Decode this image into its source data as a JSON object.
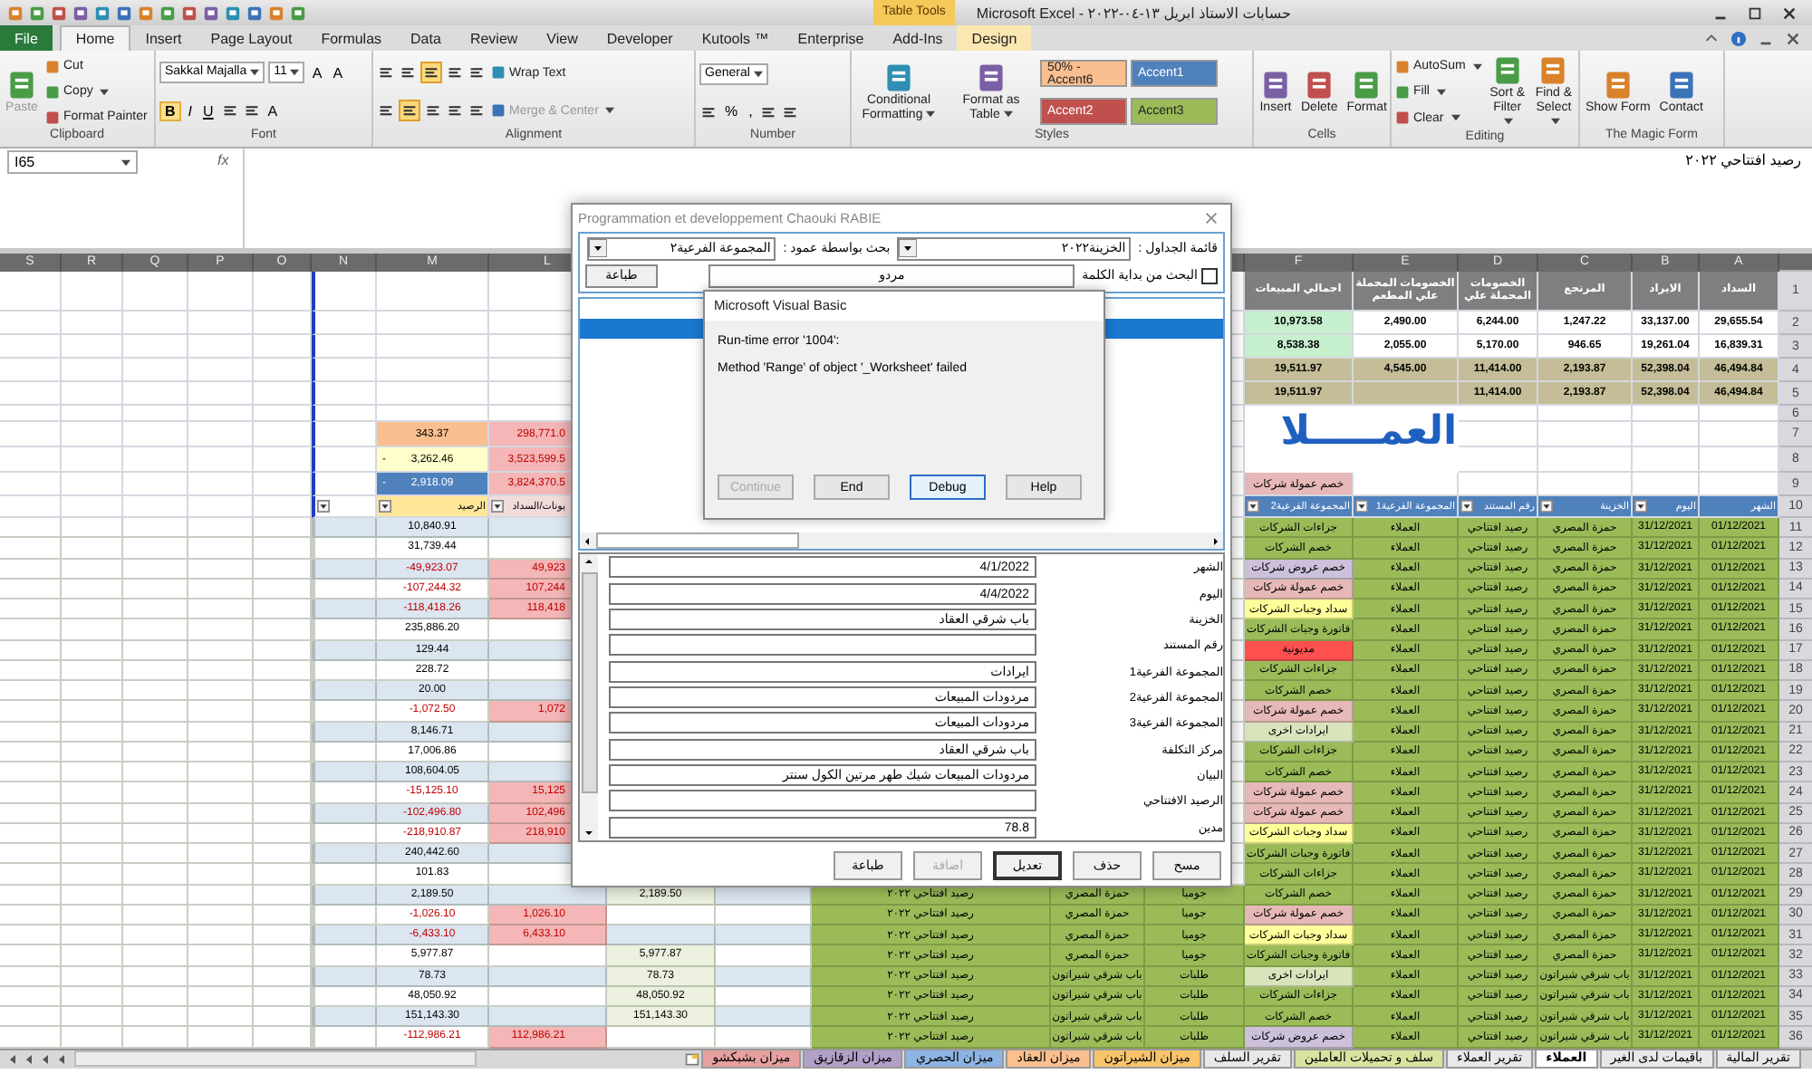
{
  "window": {
    "title": "حسابات الاستاذ ابريل ١٣-٠٤-٢٠٢٢ - Microsoft Excel",
    "contextual_tab": "Table Tools"
  },
  "ribbon": {
    "tabs": [
      {
        "label": "Design",
        "kind": "contextual",
        "selected": false
      },
      {
        "label": "Add-Ins",
        "kind": "normal",
        "selected": false
      },
      {
        "label": "Enterprise",
        "kind": "normal",
        "selected": false
      },
      {
        "label": "Kutools ™",
        "kind": "normal",
        "selected": false
      },
      {
        "label": "Developer",
        "kind": "normal",
        "selected": false
      },
      {
        "label": "View",
        "kind": "normal",
        "selected": false
      },
      {
        "label": "Review",
        "kind": "normal",
        "selected": false
      },
      {
        "label": "Data",
        "kind": "normal",
        "selected": false
      },
      {
        "label": "Formulas",
        "kind": "normal",
        "selected": false
      },
      {
        "label": "Page Layout",
        "kind": "normal",
        "selected": false
      },
      {
        "label": "Insert",
        "kind": "normal",
        "selected": false
      },
      {
        "label": "Home",
        "kind": "normal",
        "selected": true
      },
      {
        "label": "File",
        "kind": "file",
        "selected": false
      }
    ],
    "groups": [
      {
        "label": "The Magic Form",
        "columns": [
          [
            [
              {
                "kind": "large",
                "label": "Contact"
              }
            ]
          ],
          [
            [
              {
                "kind": "large",
                "label": "Show Form"
              }
            ]
          ]
        ]
      },
      {
        "label": "Editing",
        "columns": [
          [
            [
              {
                "kind": "large",
                "label": "Find & Select",
                "dropdown": true
              }
            ]
          ],
          [
            [
              {
                "kind": "large",
                "label": "Sort & Filter",
                "dropdown": true
              }
            ]
          ],
          [
            [
              {
                "kind": "small",
                "label": "AutoSum",
                "dropdown": true
              }
            ],
            [
              {
                "kind": "small",
                "label": "Fill",
                "dropdown": true
              }
            ],
            [
              {
                "kind": "small",
                "label": "Clear",
                "dropdown": true
              }
            ]
          ]
        ]
      },
      {
        "label": "Cells",
        "columns": [
          [
            [
              {
                "kind": "large",
                "label": "Format"
              }
            ]
          ],
          [
            [
              {
                "kind": "large",
                "label": "Delete"
              }
            ]
          ],
          [
            [
              {
                "kind": "large",
                "label": "Insert"
              }
            ]
          ]
        ]
      },
      {
        "label": "Styles",
        "columns": [
          [
            [
              {
                "kind": "swatch",
                "label": "Accent1",
                "color": "#4f81bd"
              },
              {
                "kind": "swatch",
                "label": "50% - Accent6",
                "color": "#fabf8f"
              }
            ],
            [
              {
                "kind": "swatch",
                "label": "Accent3",
                "color": "#9bbb59"
              },
              {
                "kind": "swatch",
                "label": "Accent2",
                "color": "#c0504d"
              }
            ]
          ],
          [
            [
              {
                "kind": "large",
                "label": "Format as Table",
                "dropdown": true
              }
            ]
          ],
          [
            [
              {
                "kind": "large",
                "label": "Conditional Formatting",
                "dropdown": true
              }
            ]
          ]
        ]
      },
      {
        "label": "Number",
        "columns": [
          [
            [
              {
                "kind": "field",
                "label": "General"
              }
            ],
            [
              {
                "kind": "icon",
                "selected": false
              },
              {
                "kind": "icon",
                "selected": false
              },
              {
                "kind": "glyph",
                "label": ","
              },
              {
                "kind": "glyph",
                "label": "%"
              },
              {
                "kind": "icon",
                "selected": false
              }
            ]
          ]
        ]
      },
      {
        "label": "Alignment",
        "columns": [
          [
            [
              {
                "kind": "small",
                "label": "Wrap Text"
              }
            ],
            [
              {
                "kind": "small",
                "label": "Merge & Center",
                "dropdown": true,
                "disabled": true
              }
            ]
          ],
          [
            [
              {
                "kind": "icon",
                "selected": false
              },
              {
                "kind": "icon",
                "selected": false
              },
              {
                "kind": "icon",
                "selected": true
              },
              {
                "kind": "icon",
                "selected": false
              },
              {
                "kind": "icon",
                "selected": false
              }
            ],
            [
              {
                "kind": "icon",
                "selected": false
              },
              {
                "kind": "icon",
                "selected": false
              },
              {
                "kind": "icon",
                "selected": false
              },
              {
                "kind": "icon",
                "selected": true
              },
              {
                "kind": "icon",
                "selected": false
              }
            ]
          ]
        ]
      },
      {
        "label": "Font",
        "columns": [
          [
            [
              {
                "kind": "glyph",
                "label": "A"
              },
              {
                "kind": "glyph",
                "label": "A"
              },
              {
                "kind": "field",
                "label": "11"
              },
              {
                "kind": "field",
                "label": "Sakkal Majalla"
              }
            ],
            [
              {
                "kind": "glyph",
                "label": "A"
              },
              {
                "kind": "icon",
                "selected": false
              },
              {
                "kind": "icon",
                "selected": false
              },
              {
                "kind": "underline",
                "label": "U"
              },
              {
                "kind": "italic",
                "label": "I"
              },
              {
                "kind": "bold",
                "label": "B"
              }
            ]
          ]
        ]
      },
      {
        "label": "Clipboard",
        "columns": [
          [
            [
              {
                "kind": "small",
                "label": "Cut"
              }
            ],
            [
              {
                "kind": "small",
                "label": "Copy",
                "dropdown": true
              }
            ],
            [
              {
                "kind": "small",
                "label": "Format Painter"
              }
            ]
          ],
          [
            [
              {
                "kind": "large",
                "label": "Paste",
                "disabled": true
              }
            ]
          ]
        ]
      }
    ]
  },
  "formula_bar": {
    "name_box": "I65",
    "fx": "fx",
    "content": "رصيد افتتاحي ٢٠٢٢"
  },
  "sheet": {
    "columns": [
      "A",
      "B",
      "C",
      "D",
      "E",
      "F",
      "L",
      "M",
      "N",
      "O",
      "P",
      "Q",
      "R",
      "S"
    ],
    "title": "العمـــــلا",
    "rows": [
      {
        "row": "1",
        "kind": "head",
        "cells": {
          "F": {
            "text": "اجمالي المبيعات",
            "color": "#7f7f7f"
          },
          "E": {
            "text": "الخصومات المحملة علي المطعم",
            "color": "#7f7f7f"
          },
          "D": {
            "text": "الخصومات المحملة علي",
            "color": "#7f7f7f"
          },
          "C": {
            "text": "المرتجع",
            "color": "#7f7f7f"
          },
          "B": {
            "text": "الايراد",
            "color": "#7f7f7f"
          },
          "A": {
            "text": "السداد",
            "color": "#7f7f7f"
          }
        }
      },
      {
        "row": "2",
        "kind": "summary",
        "cells": {
          "F": {
            "text": "10,973.58",
            "color": "#c6efce"
          },
          "E": {
            "text": "2,490.00"
          },
          "D": {
            "text": "6,244.00"
          },
          "C": {
            "text": "1,247.22"
          },
          "B": {
            "text": "33,137.00"
          },
          "A": {
            "text": "29,655.54"
          }
        }
      },
      {
        "row": "3",
        "kind": "summary",
        "cells": {
          "F": {
            "text": "8,538.38",
            "color": "#c6efce"
          },
          "E": {
            "text": "2,055.00"
          },
          "D": {
            "text": "5,170.00"
          },
          "C": {
            "text": "946.65"
          },
          "B": {
            "text": "19,261.04"
          },
          "A": {
            "text": "16,839.31"
          }
        }
      },
      {
        "row": "4",
        "kind": "summary",
        "cells": {
          "F": {
            "text": "19,511.97",
            "color": "#c4bd97"
          },
          "E": {
            "text": "4,545.00",
            "color": "#c4bd97"
          },
          "D": {
            "text": "11,414.00",
            "color": "#c4bd97"
          },
          "C": {
            "text": "2,193.87",
            "color": "#c4bd97"
          },
          "B": {
            "text": "52,398.04",
            "color": "#c4bd97"
          },
          "A": {
            "text": "46,494.84",
            "color": "#c4bd97"
          }
        }
      },
      {
        "row": "5",
        "kind": "summary",
        "cells": {
          "F": {
            "text": "19,511.97",
            "color": "#c4bd97"
          },
          "E": {
            "color": "#c4bd97"
          },
          "D": {
            "text": "11,414.00",
            "color": "#c4bd97"
          },
          "C": {
            "text": "2,193.87",
            "color": "#c4bd97"
          },
          "B": {
            "text": "52,398.04",
            "color": "#c4bd97"
          },
          "A": {
            "text": "46,494.84",
            "color": "#c4bd97"
          }
        }
      },
      {
        "row": "6"
      },
      {
        "row": "7",
        "cells": {
          "M": {
            "text": "343.37",
            "color": "#fabf8f"
          },
          "L": {
            "text": "298,771.0",
            "color": "#f4b6b6",
            "negative": true
          }
        }
      },
      {
        "row": "8",
        "cells": {
          "M": {
            "text": "3,262.46",
            "prefix": "-",
            "color": "#ffffcc"
          },
          "L": {
            "text": "3,523,599.5",
            "color": "#f4b6b6",
            "negative": true
          }
        }
      },
      {
        "row": "9",
        "cells": {
          "M": {
            "text": "2,918.09",
            "prefix": "-",
            "color": "#4f81bd"
          },
          "L": {
            "text": "3,824,370.5",
            "color": "#f4b6b6",
            "negative": true
          },
          "F": {
            "text": "خصم عمولة شركات",
            "color": "#e6b8b7"
          }
        }
      },
      {
        "row": "10",
        "kind": "table_head",
        "cells": {
          "N": {
            "filter": true
          },
          "M": {
            "text": "الرصيد",
            "color": "#ffe699",
            "filter": true
          },
          "L": {
            "text": "يونات/السداد",
            "color": "#f2dcdb",
            "filter": true
          },
          "F": {
            "text": "المجموعة الفرعية2",
            "color": "#4f81bd",
            "filter": true
          },
          "E": {
            "text": "المجموعة الفرعية1",
            "color": "#4f81bd",
            "filter": true
          },
          "D": {
            "text": "رقم المستند",
            "color": "#4f81bd",
            "filter": true
          },
          "C": {
            "text": "الخزينة",
            "color": "#4f81bd",
            "filter": true
          },
          "B": {
            "text": "اليوم",
            "color": "#4f81bd",
            "filter": true
          },
          "A": {
            "text": "الشهر",
            "color": "#4f81bd"
          }
        }
      },
      {
        "row": "11",
        "kind": "data",
        "cells": {
          "M": {
            "text": "10,840.91"
          },
          "F": {
            "text": "جزاءات الشركات"
          },
          "E": {
            "text": "العملاء"
          },
          "D": {
            "text": "رصيد افتتاحي"
          },
          "C": {
            "text": "حمزة المصري"
          },
          "B": {
            "text": "31/12/2021"
          },
          "A": {
            "text": "01/12/2021"
          }
        }
      },
      {
        "row": "12",
        "kind": "data",
        "cells": {
          "M": {
            "text": "31,739.44"
          },
          "F": {
            "text": "خصم الشركات"
          },
          "E": {
            "text": "العملاء"
          },
          "D": {
            "text": "رصيد افتتاحي"
          },
          "C": {
            "text": "حمزة المصري"
          },
          "B": {
            "text": "31/12/2021"
          },
          "A": {
            "text": "01/12/2021"
          }
        }
      },
      {
        "row": "13",
        "kind": "data",
        "cells": {
          "M": {
            "text": "-49,923.07",
            "negative": true
          },
          "L": {
            "text": "49,923",
            "color": "#f4b6b6",
            "negative": true
          },
          "F": {
            "text": "خصم عروض شركات",
            "color": "#ccc0da"
          },
          "E": {
            "text": "العملاء"
          },
          "D": {
            "text": "رصيد افتتاحي"
          },
          "C": {
            "text": "حمزة المصري"
          },
          "B": {
            "text": "31/12/2021"
          },
          "A": {
            "text": "01/12/2021"
          }
        }
      },
      {
        "row": "14",
        "kind": "data",
        "cells": {
          "M": {
            "text": "-107,244.32",
            "negative": true
          },
          "L": {
            "text": "107,244",
            "color": "#f4b6b6",
            "negative": true
          },
          "F": {
            "text": "خصم عمولة شركات",
            "color": "#e6b8b7"
          },
          "E": {
            "text": "العملاء"
          },
          "D": {
            "text": "رصيد افتتاحي"
          },
          "C": {
            "text": "حمزة المصري"
          },
          "B": {
            "text": "31/12/2021"
          },
          "A": {
            "text": "01/12/2021"
          }
        }
      },
      {
        "row": "15",
        "kind": "data",
        "cells": {
          "M": {
            "text": "-118,418.26",
            "negative": true
          },
          "L": {
            "text": "118,418",
            "color": "#f4b6b6",
            "negative": true
          },
          "F": {
            "text": "سداد وجبات الشركات",
            "color": "#ffff99"
          },
          "E": {
            "text": "العملاء"
          },
          "D": {
            "text": "رصيد افتتاحي"
          },
          "C": {
            "text": "حمزة المصري"
          },
          "B": {
            "text": "31/12/2021"
          },
          "A": {
            "text": "01/12/2021"
          }
        }
      },
      {
        "row": "16",
        "kind": "data",
        "cells": {
          "M": {
            "text": "235,886.20"
          },
          "F": {
            "text": "فاتورة وجبات الشركات"
          },
          "E": {
            "text": "العملاء"
          },
          "D": {
            "text": "رصيد افتتاحي"
          },
          "C": {
            "text": "حمزة المصري"
          },
          "B": {
            "text": "31/12/2021"
          },
          "A": {
            "text": "01/12/2021"
          }
        }
      },
      {
        "row": "17",
        "kind": "data",
        "cells": {
          "M": {
            "text": "129.44"
          },
          "F": {
            "text": "مديونية",
            "color": "#ff5050"
          },
          "E": {
            "text": "العملاء"
          },
          "D": {
            "text": "رصيد افتتاحي"
          },
          "C": {
            "text": "حمزة المصري"
          },
          "B": {
            "text": "31/12/2021"
          },
          "A": {
            "text": "01/12/2021"
          }
        }
      },
      {
        "row": "18",
        "kind": "data",
        "cells": {
          "M": {
            "text": "228.72"
          },
          "F": {
            "text": "جزاءات الشركات"
          },
          "E": {
            "text": "العملاء"
          },
          "D": {
            "text": "رصيد افتتاحي"
          },
          "C": {
            "text": "حمزة المصري"
          },
          "B": {
            "text": "31/12/2021"
          },
          "A": {
            "text": "01/12/2021"
          }
        }
      },
      {
        "row": "19",
        "kind": "data",
        "cells": {
          "M": {
            "text": "20.00"
          },
          "F": {
            "text": "خصم الشركات"
          },
          "E": {
            "text": "العملاء"
          },
          "D": {
            "text": "رصيد افتتاحي"
          },
          "C": {
            "text": "حمزة المصري"
          },
          "B": {
            "text": "31/12/2021"
          },
          "A": {
            "text": "01/12/2021"
          }
        }
      },
      {
        "row": "20",
        "kind": "data",
        "cells": {
          "M": {
            "text": "-1,072.50",
            "negative": true
          },
          "L": {
            "text": "1,072",
            "color": "#f4b6b6",
            "negative": true
          },
          "F": {
            "text": "خصم عمولة شركات",
            "color": "#e6b8b7"
          },
          "E": {
            "text": "العملاء"
          },
          "D": {
            "text": "رصيد افتتاحي"
          },
          "C": {
            "text": "حمزة المصري"
          },
          "B": {
            "text": "31/12/2021"
          },
          "A": {
            "text": "01/12/2021"
          }
        }
      },
      {
        "row": "21",
        "kind": "data",
        "cells": {
          "M": {
            "text": "8,146.71"
          },
          "F": {
            "text": "ايرادات اخرى",
            "color": "#d8e4bc"
          },
          "E": {
            "text": "العملاء"
          },
          "D": {
            "text": "رصيد افتتاحي"
          },
          "C": {
            "text": "حمزة المصري"
          },
          "B": {
            "text": "31/12/2021"
          },
          "A": {
            "text": "01/12/2021"
          }
        }
      },
      {
        "row": "22",
        "kind": "data",
        "cells": {
          "M": {
            "text": "17,006.86"
          },
          "F": {
            "text": "جزاءات الشركات"
          },
          "E": {
            "text": "العملاء"
          },
          "D": {
            "text": "رصيد افتتاحي"
          },
          "C": {
            "text": "حمزة المصري"
          },
          "B": {
            "text": "31/12/2021"
          },
          "A": {
            "text": "01/12/2021"
          }
        }
      },
      {
        "row": "23",
        "kind": "data",
        "cells": {
          "M": {
            "text": "108,604.05"
          },
          "F": {
            "text": "خصم الشركات"
          },
          "E": {
            "text": "العملاء"
          },
          "D": {
            "text": "رصيد افتتاحي"
          },
          "C": {
            "text": "حمزة المصري"
          },
          "B": {
            "text": "31/12/2021"
          },
          "A": {
            "text": "01/12/2021"
          }
        }
      },
      {
        "row": "24",
        "kind": "data",
        "cells": {
          "M": {
            "text": "-15,125.10",
            "negative": true
          },
          "L": {
            "text": "15,125",
            "color": "#f4b6b6",
            "negative": true
          },
          "F": {
            "text": "خصم عمولة شركات",
            "color": "#e6b8b7"
          },
          "E": {
            "text": "العملاء"
          },
          "D": {
            "text": "رصيد افتتاحي"
          },
          "C": {
            "text": "حمزة المصري"
          },
          "B": {
            "text": "31/12/2021"
          },
          "A": {
            "text": "01/12/2021"
          }
        }
      },
      {
        "row": "25",
        "kind": "data",
        "cells": {
          "M": {
            "text": "-102,496.80",
            "negative": true
          },
          "L": {
            "text": "102,496",
            "color": "#f4b6b6",
            "negative": true
          },
          "F": {
            "text": "خصم عمولة شركات",
            "color": "#e6b8b7"
          },
          "E": {
            "text": "العملاء"
          },
          "D": {
            "text": "رصيد افتتاحي"
          },
          "C": {
            "text": "حمزة المصري"
          },
          "B": {
            "text": "31/12/2021"
          },
          "A": {
            "text": "01/12/2021"
          }
        }
      },
      {
        "row": "26",
        "kind": "data",
        "cells": {
          "M": {
            "text": "-218,910.87",
            "negative": true
          },
          "L": {
            "text": "218,910",
            "color": "#f4b6b6",
            "negative": true
          },
          "F": {
            "text": "سداد وجبات الشركات",
            "color": "#ffff99"
          },
          "E": {
            "text": "العملاء"
          },
          "D": {
            "text": "رصيد افتتاحي"
          },
          "C": {
            "text": "حمزة المصري"
          },
          "B": {
            "text": "31/12/2021"
          },
          "A": {
            "text": "01/12/2021"
          }
        }
      },
      {
        "row": "27",
        "kind": "data",
        "cells": {
          "M": {
            "text": "240,442.60"
          },
          "F": {
            "text": "فاتورة وجبات الشركات"
          },
          "E": {
            "text": "العملاء"
          },
          "D": {
            "text": "رصيد افتتاحي"
          },
          "C": {
            "text": "حمزة المصري"
          },
          "B": {
            "text": "31/12/2021"
          },
          "A": {
            "text": "01/12/2021"
          }
        }
      },
      {
        "row": "28",
        "kind": "data",
        "cells": {
          "M": {
            "text": "101.83"
          },
          "F": {
            "text": "جزاءات الشركات"
          },
          "E": {
            "text": "العملاء"
          },
          "D": {
            "text": "رصيد افتتاحي"
          },
          "C": {
            "text": "حمزة المصري"
          },
          "B": {
            "text": "31/12/2021"
          },
          "A": {
            "text": "01/12/2021"
          }
        }
      },
      {
        "row": "29",
        "kind": "data",
        "cells": {
          "M": {
            "text": "2,189.50"
          },
          "K": {
            "text": "2,189.50",
            "color": "#ebf1de"
          },
          "I": {
            "text": "رصيد افتتاحي ٢٠٢٢"
          },
          "H": {
            "text": "حمزة المصري"
          },
          "G": {
            "text": "جوميا"
          },
          "F": {
            "text": "خصم الشركات"
          },
          "E": {
            "text": "العملاء"
          },
          "D": {
            "text": "رصيد افتتاحي"
          },
          "C": {
            "text": "حمزة المصري"
          },
          "B": {
            "text": "31/12/2021"
          },
          "A": {
            "text": "01/12/2021"
          }
        }
      },
      {
        "row": "30",
        "kind": "data",
        "cells": {
          "M": {
            "text": "-1,026.10",
            "negative": true
          },
          "L": {
            "text": "1,026.10",
            "color": "#f4b6b6",
            "negative": true
          },
          "I": {
            "text": "رصيد افتتاحي ٢٠٢٢"
          },
          "H": {
            "text": "حمزة المصري"
          },
          "G": {
            "text": "جوميا"
          },
          "F": {
            "text": "خصم عمولة شركات",
            "color": "#e6b8b7"
          },
          "E": {
            "text": "العملاء"
          },
          "D": {
            "text": "رصيد افتتاحي"
          },
          "C": {
            "text": "حمزة المصري"
          },
          "B": {
            "text": "31/12/2021"
          },
          "A": {
            "text": "01/12/2021"
          }
        }
      },
      {
        "row": "31",
        "kind": "data",
        "cells": {
          "M": {
            "text": "-6,433.10",
            "negative": true
          },
          "L": {
            "text": "6,433.10",
            "color": "#f4b6b6",
            "negative": true
          },
          "I": {
            "text": "رصيد افتتاحي ٢٠٢٢"
          },
          "H": {
            "text": "حمزة المصري"
          },
          "G": {
            "text": "جوميا"
          },
          "F": {
            "text": "سداد وجبات الشركات",
            "color": "#ffff99"
          },
          "E": {
            "text": "العملاء"
          },
          "D": {
            "text": "رصيد افتتاحي"
          },
          "C": {
            "text": "حمزة المصري"
          },
          "B": {
            "text": "31/12/2021"
          },
          "A": {
            "text": "01/12/2021"
          }
        }
      },
      {
        "row": "32",
        "kind": "data",
        "cells": {
          "M": {
            "text": "5,977.87"
          },
          "K": {
            "text": "5,977.87",
            "color": "#ebf1de"
          },
          "I": {
            "text": "رصيد افتتاحي ٢٠٢٢"
          },
          "H": {
            "text": "حمزة المصري"
          },
          "G": {
            "text": "جوميا"
          },
          "F": {
            "text": "فاتورة وجبات الشركات"
          },
          "E": {
            "text": "العملاء"
          },
          "D": {
            "text": "رصيد افتتاحي"
          },
          "C": {
            "text": "حمزة المصري"
          },
          "B": {
            "text": "31/12/2021"
          },
          "A": {
            "text": "01/12/2021"
          }
        }
      },
      {
        "row": "33",
        "kind": "data",
        "cells": {
          "M": {
            "text": "78.73"
          },
          "K": {
            "text": "78.73",
            "color": "#ebf1de"
          },
          "I": {
            "text": "رصيد افتتاحي ٢٠٢٢"
          },
          "H": {
            "text": "باب شرقي شيراتون"
          },
          "G": {
            "text": "طلبات"
          },
          "F": {
            "text": "ايرادات اخرى",
            "color": "#d8e4bc"
          },
          "E": {
            "text": "العملاء"
          },
          "D": {
            "text": "رصيد افتتاحي"
          },
          "C": {
            "text": "باب شرقي شيراتون"
          },
          "B": {
            "text": "31/12/2021"
          },
          "A": {
            "text": "01/12/2021"
          }
        }
      },
      {
        "row": "34",
        "kind": "data",
        "cells": {
          "M": {
            "text": "48,050.92"
          },
          "K": {
            "text": "48,050.92",
            "color": "#ebf1de"
          },
          "I": {
            "text": "رصيد افتتاحي ٢٠٢٢"
          },
          "H": {
            "text": "باب شرقي شيراتون"
          },
          "G": {
            "text": "طلبات"
          },
          "F": {
            "text": "جزاءات الشركات"
          },
          "E": {
            "text": "العملاء"
          },
          "D": {
            "text": "رصيد افتتاحي"
          },
          "C": {
            "text": "باب شرقي شيراتون"
          },
          "B": {
            "text": "31/12/2021"
          },
          "A": {
            "text": "01/12/2021"
          }
        }
      },
      {
        "row": "35",
        "kind": "data",
        "cells": {
          "M": {
            "text": "151,143.30"
          },
          "K": {
            "text": "151,143.30",
            "color": "#ebf1de"
          },
          "I": {
            "text": "رصيد افتتاحي ٢٠٢٢"
          },
          "H": {
            "text": "باب شرقي شيراتون"
          },
          "G": {
            "text": "طلبات"
          },
          "F": {
            "text": "خصم الشركات"
          },
          "E": {
            "text": "العملاء"
          },
          "D": {
            "text": "رصيد افتتاحي"
          },
          "C": {
            "text": "باب شرقي شيراتون"
          },
          "B": {
            "text": "31/12/2021"
          },
          "A": {
            "text": "01/12/2021"
          }
        }
      },
      {
        "row": "36",
        "kind": "data",
        "cells": {
          "M": {
            "text": "-112,986.21",
            "negative": true
          },
          "L": {
            "text": "112,986.21",
            "color": "#f4b6b6",
            "negative": true
          },
          "I": {
            "text": "رصيد افتتاحي ٢٠٢٢"
          },
          "H": {
            "text": "باب شرقي شيراتون"
          },
          "G": {
            "text": "طلبات"
          },
          "F": {
            "text": "خصم عروض شركات",
            "color": "#ccc0da"
          },
          "E": {
            "text": "العملاء"
          },
          "D": {
            "text": "رصيد افتتاحي"
          },
          "C": {
            "text": "باب شرقي شيراتون"
          },
          "B": {
            "text": "31/12/2021"
          },
          "A": {
            "text": "01/12/2021"
          }
        }
      }
    ]
  },
  "sheet_tabs": [
    {
      "label": "تقرير المالية",
      "selected": false
    },
    {
      "label": "باقيمات لدى الغير",
      "selected": false
    },
    {
      "label": "العملاء",
      "selected": true
    },
    {
      "label": "تقرير العملاء",
      "selected": false
    },
    {
      "label": "سلف و تحميلات العاملين",
      "selected": false,
      "color": "#d7e4a0"
    },
    {
      "label": "تقرير السلف",
      "selected": false
    },
    {
      "label": "ميزان الشيراتون",
      "selected": false,
      "color": "#f7c46c"
    },
    {
      "label": "ميزان العقاد",
      "selected": false,
      "color": "#fabf8f"
    },
    {
      "label": "ميزان الحصري",
      "selected": false,
      "color": "#8db4e2"
    },
    {
      "label": "ميزان الزقازيق",
      "selected": false,
      "color": "#b1a0c7"
    },
    {
      "label": "ميزان بشبكشو",
      "selected": false,
      "color": "#e6a0a0"
    }
  ],
  "dialog": {
    "title": "Programmation et developpement Chaouki RABIE",
    "table_label": "قائمة الجداول :",
    "table_value": "الخزينة٢٠٢٢",
    "column_label": "بحث بواسطة عمود :",
    "column_value": "المجموعة الفرعية٢",
    "prefix_search": {
      "label": "البحث من بداية الكلمة",
      "checked": false
    },
    "search_value": "مردو",
    "print_button": "طباعة",
    "list_rows": [
      {
        "selected": false
      },
      {
        "selected": true
      }
    ],
    "fields": [
      {
        "label": "الشهر",
        "value": "4/1/2022"
      },
      {
        "label": "اليوم",
        "value": "4/4/2022"
      },
      {
        "label": "الخزينة",
        "value": "باب شرقي العقاد"
      },
      {
        "label": "رقم المستند"
      },
      {
        "label": "المجموعة الفرعية1",
        "value": "ايرادات"
      },
      {
        "label": "المجموعة الفرعية2",
        "value": "مردودات المبيعات"
      },
      {
        "label": "المجموعة الفرعية3",
        "value": "مردودات المبيعات"
      },
      {
        "label": "مركز التكلفة",
        "value": "باب شرقي العقاد"
      },
      {
        "label": "البيان",
        "value": "مردودات المبيعات شيك طهر مرتين الكول سنتر"
      },
      {
        "label": "الرصيد الافتتاحي"
      },
      {
        "label": "مدين",
        "value": "78.8"
      }
    ],
    "buttons": [
      {
        "label": "مسح",
        "disabled": false,
        "default": false
      },
      {
        "label": "حذف",
        "disabled": false,
        "default": false
      },
      {
        "label": "تعديل",
        "disabled": false,
        "default": true
      },
      {
        "label": "اضافة",
        "disabled": true,
        "default": false
      },
      {
        "label": "طباعة",
        "disabled": false,
        "default": false
      }
    ]
  },
  "error": {
    "title": "Microsoft Visual Basic",
    "code": "Run-time error '1004':",
    "message": "Method 'Range' of object '_Worksheet' failed",
    "buttons": [
      {
        "label": "Help",
        "disabled": false,
        "focused": false
      },
      {
        "label": "Debug",
        "disabled": false,
        "focused": true
      },
      {
        "label": "End",
        "disabled": false,
        "focused": false
      },
      {
        "label": "Continue",
        "disabled": true,
        "focused": false
      }
    ]
  }
}
